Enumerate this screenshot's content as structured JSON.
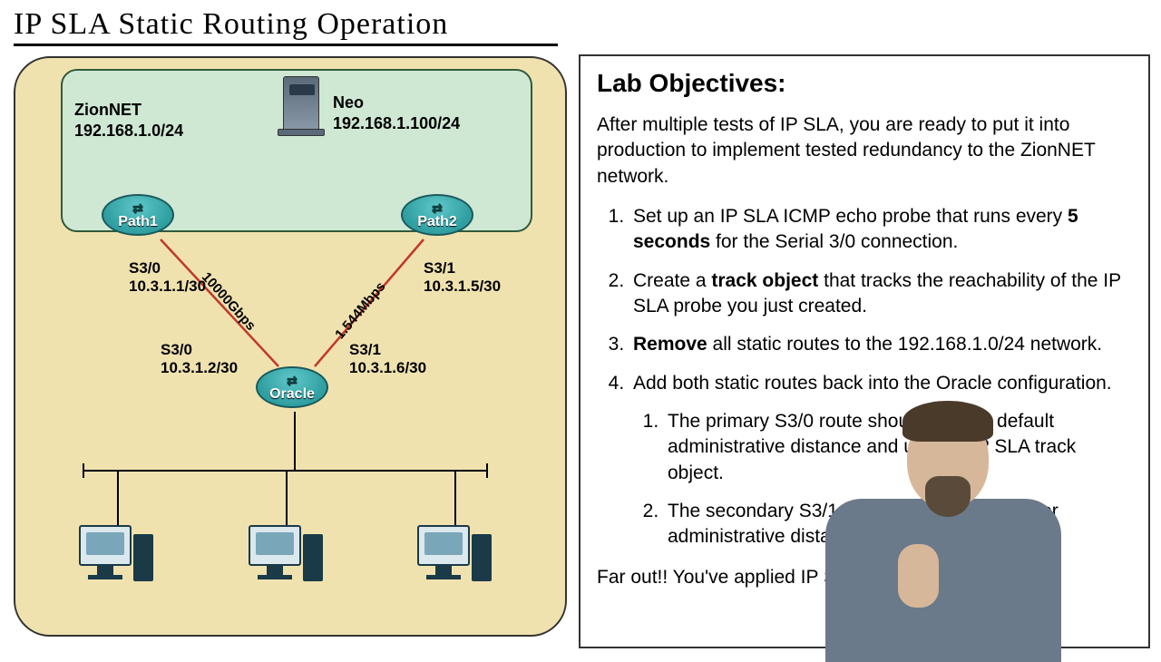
{
  "title": "IP SLA Static Routing Operation",
  "diagram": {
    "zion_name": "ZionNET",
    "zion_subnet": "192.168.1.0/24",
    "neo_name": "Neo",
    "neo_ip": "192.168.1.100/24",
    "routers": {
      "path1": {
        "label": "Path1",
        "int": "S3/0",
        "ip": "10.3.1.1/30"
      },
      "path2": {
        "label": "Path2",
        "int": "S3/1",
        "ip": "10.3.1.5/30"
      },
      "oracle_left": {
        "int": "S3/0",
        "ip": "10.3.1.2/30"
      },
      "oracle_right": {
        "int": "S3/1",
        "ip": "10.3.1.6/30"
      },
      "oracle": {
        "label": "Oracle"
      }
    },
    "links": {
      "left_speed": "10000Gbps",
      "right_speed": "1.544Mbps"
    }
  },
  "objectives": {
    "heading": "Lab Objectives:",
    "intro": "After multiple tests of IP SLA, you are ready to put it into production to implement tested redundancy to the ZionNET network.",
    "item1_a": "Set up an IP SLA ICMP echo probe that runs every ",
    "item1_b": "5 seconds",
    "item1_c": " for the Serial 3/0 connection.",
    "item2_a": "Create a ",
    "item2_b": "track object",
    "item2_c": " that tracks the reachability of the IP SLA probe you just created.",
    "item3_a": "Remove",
    "item3_b": " all static routes to the 192.168.1.0/24 network.",
    "item4": "Add both static routes back into the Oracle configuration.",
    "item4_1": "The primary S3/0 route should use the default administrative distance and use the IP SLA track object.",
    "item4_2": "The secondary S3/1 route should use a higher administrative distance and no track object.",
    "outro": "Far out!! You've applied IP SLA to static routing!"
  }
}
